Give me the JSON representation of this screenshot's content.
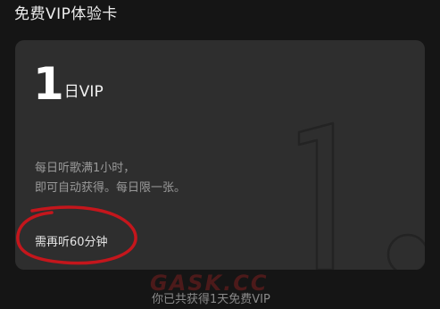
{
  "section": {
    "title": "免费VIP体验卡"
  },
  "card": {
    "badge_number": "1",
    "badge_unit": "日VIP",
    "description_lines": [
      "每日听歌满1小时，",
      "即可自动获得。每日限一张。"
    ],
    "status": "需再听60分钟"
  },
  "watermark": {
    "text": "GASK.CC"
  },
  "footer": {
    "note": "你已共获得1天免费VIP"
  },
  "colors": {
    "page_bg": "#151515",
    "card_bg": "#2e2e2e",
    "annotation_red": "#c4161c"
  }
}
